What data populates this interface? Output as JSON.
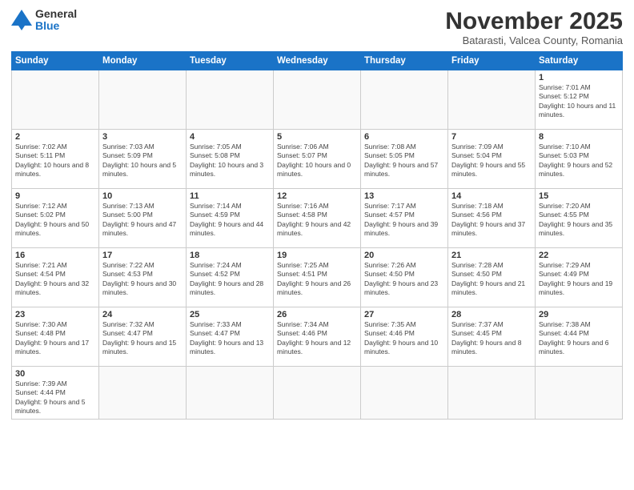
{
  "header": {
    "logo_line1": "General",
    "logo_line2": "Blue",
    "month_title": "November 2025",
    "subtitle": "Batarasti, Valcea County, Romania"
  },
  "weekdays": [
    "Sunday",
    "Monday",
    "Tuesday",
    "Wednesday",
    "Thursday",
    "Friday",
    "Saturday"
  ],
  "weeks": [
    [
      {
        "day": "",
        "info": ""
      },
      {
        "day": "",
        "info": ""
      },
      {
        "day": "",
        "info": ""
      },
      {
        "day": "",
        "info": ""
      },
      {
        "day": "",
        "info": ""
      },
      {
        "day": "",
        "info": ""
      },
      {
        "day": "1",
        "info": "Sunrise: 7:01 AM\nSunset: 5:12 PM\nDaylight: 10 hours and 11 minutes."
      }
    ],
    [
      {
        "day": "2",
        "info": "Sunrise: 7:02 AM\nSunset: 5:11 PM\nDaylight: 10 hours and 8 minutes."
      },
      {
        "day": "3",
        "info": "Sunrise: 7:03 AM\nSunset: 5:09 PM\nDaylight: 10 hours and 5 minutes."
      },
      {
        "day": "4",
        "info": "Sunrise: 7:05 AM\nSunset: 5:08 PM\nDaylight: 10 hours and 3 minutes."
      },
      {
        "day": "5",
        "info": "Sunrise: 7:06 AM\nSunset: 5:07 PM\nDaylight: 10 hours and 0 minutes."
      },
      {
        "day": "6",
        "info": "Sunrise: 7:08 AM\nSunset: 5:05 PM\nDaylight: 9 hours and 57 minutes."
      },
      {
        "day": "7",
        "info": "Sunrise: 7:09 AM\nSunset: 5:04 PM\nDaylight: 9 hours and 55 minutes."
      },
      {
        "day": "8",
        "info": "Sunrise: 7:10 AM\nSunset: 5:03 PM\nDaylight: 9 hours and 52 minutes."
      }
    ],
    [
      {
        "day": "9",
        "info": "Sunrise: 7:12 AM\nSunset: 5:02 PM\nDaylight: 9 hours and 50 minutes."
      },
      {
        "day": "10",
        "info": "Sunrise: 7:13 AM\nSunset: 5:00 PM\nDaylight: 9 hours and 47 minutes."
      },
      {
        "day": "11",
        "info": "Sunrise: 7:14 AM\nSunset: 4:59 PM\nDaylight: 9 hours and 44 minutes."
      },
      {
        "day": "12",
        "info": "Sunrise: 7:16 AM\nSunset: 4:58 PM\nDaylight: 9 hours and 42 minutes."
      },
      {
        "day": "13",
        "info": "Sunrise: 7:17 AM\nSunset: 4:57 PM\nDaylight: 9 hours and 39 minutes."
      },
      {
        "day": "14",
        "info": "Sunrise: 7:18 AM\nSunset: 4:56 PM\nDaylight: 9 hours and 37 minutes."
      },
      {
        "day": "15",
        "info": "Sunrise: 7:20 AM\nSunset: 4:55 PM\nDaylight: 9 hours and 35 minutes."
      }
    ],
    [
      {
        "day": "16",
        "info": "Sunrise: 7:21 AM\nSunset: 4:54 PM\nDaylight: 9 hours and 32 minutes."
      },
      {
        "day": "17",
        "info": "Sunrise: 7:22 AM\nSunset: 4:53 PM\nDaylight: 9 hours and 30 minutes."
      },
      {
        "day": "18",
        "info": "Sunrise: 7:24 AM\nSunset: 4:52 PM\nDaylight: 9 hours and 28 minutes."
      },
      {
        "day": "19",
        "info": "Sunrise: 7:25 AM\nSunset: 4:51 PM\nDaylight: 9 hours and 26 minutes."
      },
      {
        "day": "20",
        "info": "Sunrise: 7:26 AM\nSunset: 4:50 PM\nDaylight: 9 hours and 23 minutes."
      },
      {
        "day": "21",
        "info": "Sunrise: 7:28 AM\nSunset: 4:50 PM\nDaylight: 9 hours and 21 minutes."
      },
      {
        "day": "22",
        "info": "Sunrise: 7:29 AM\nSunset: 4:49 PM\nDaylight: 9 hours and 19 minutes."
      }
    ],
    [
      {
        "day": "23",
        "info": "Sunrise: 7:30 AM\nSunset: 4:48 PM\nDaylight: 9 hours and 17 minutes."
      },
      {
        "day": "24",
        "info": "Sunrise: 7:32 AM\nSunset: 4:47 PM\nDaylight: 9 hours and 15 minutes."
      },
      {
        "day": "25",
        "info": "Sunrise: 7:33 AM\nSunset: 4:47 PM\nDaylight: 9 hours and 13 minutes."
      },
      {
        "day": "26",
        "info": "Sunrise: 7:34 AM\nSunset: 4:46 PM\nDaylight: 9 hours and 12 minutes."
      },
      {
        "day": "27",
        "info": "Sunrise: 7:35 AM\nSunset: 4:46 PM\nDaylight: 9 hours and 10 minutes."
      },
      {
        "day": "28",
        "info": "Sunrise: 7:37 AM\nSunset: 4:45 PM\nDaylight: 9 hours and 8 minutes."
      },
      {
        "day": "29",
        "info": "Sunrise: 7:38 AM\nSunset: 4:44 PM\nDaylight: 9 hours and 6 minutes."
      }
    ],
    [
      {
        "day": "30",
        "info": "Sunrise: 7:39 AM\nSunset: 4:44 PM\nDaylight: 9 hours and 5 minutes."
      },
      {
        "day": "",
        "info": ""
      },
      {
        "day": "",
        "info": ""
      },
      {
        "day": "",
        "info": ""
      },
      {
        "day": "",
        "info": ""
      },
      {
        "day": "",
        "info": ""
      },
      {
        "day": "",
        "info": ""
      }
    ]
  ]
}
